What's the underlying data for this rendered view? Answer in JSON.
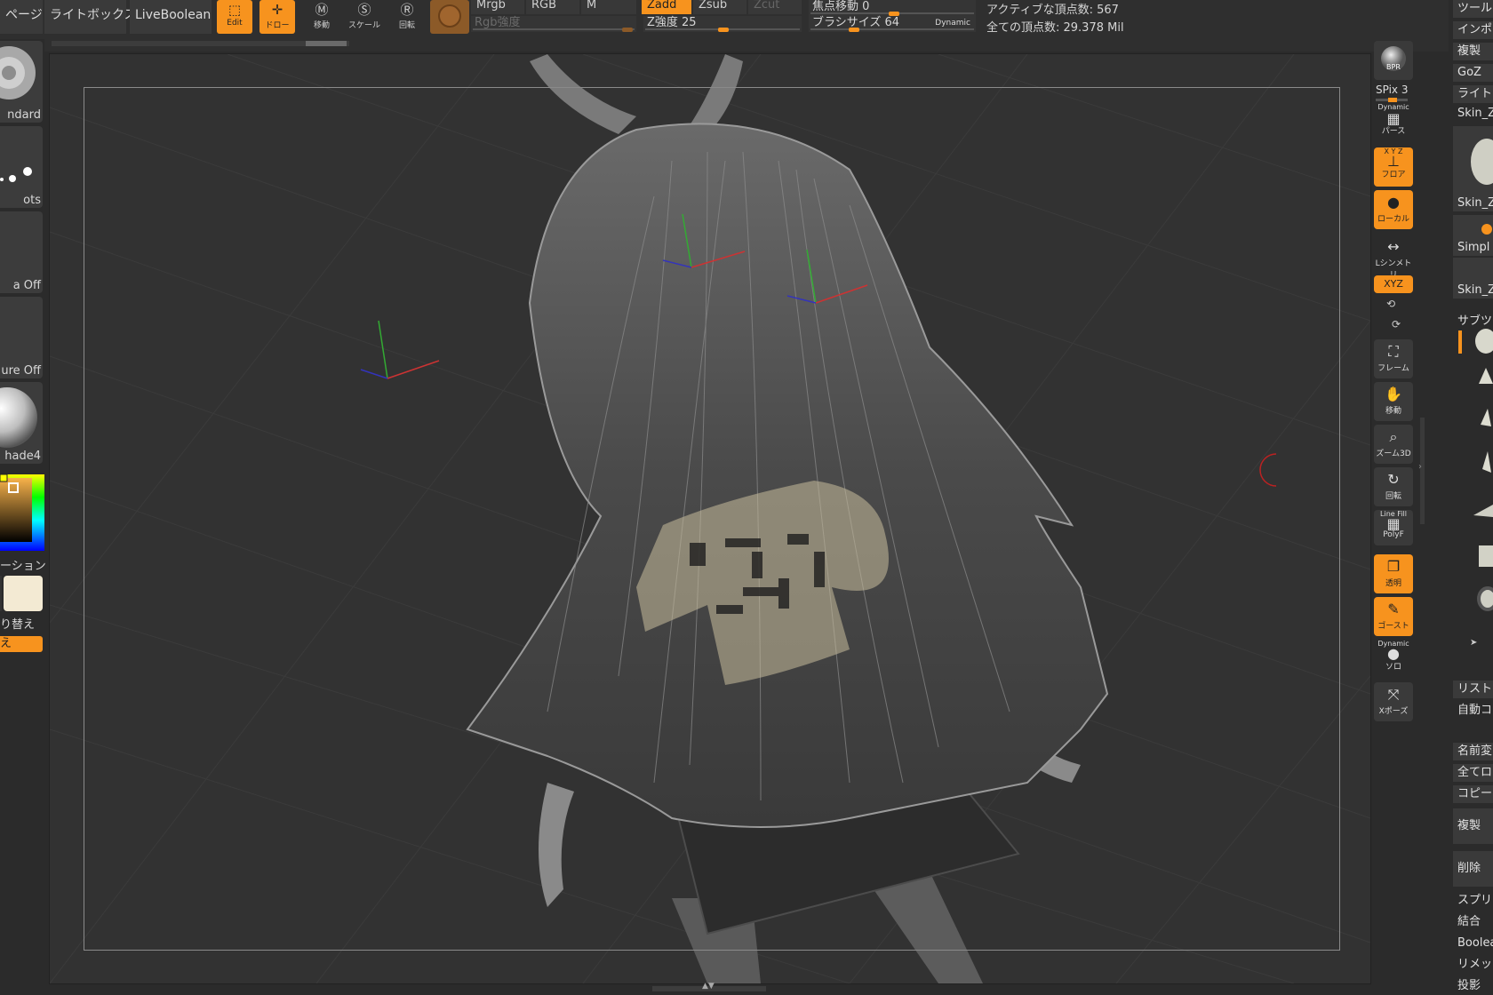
{
  "topbar": {
    "page_partial": "ページ",
    "lightbox": "ライトボックス",
    "liveboolean": "LiveBoolean",
    "edit": "Edit",
    "draw": "ドロー",
    "move": "移動",
    "scale": "スケール",
    "rotate": "回転",
    "mrgb": "Mrgb",
    "rgb": "RGB",
    "m": "M",
    "zadd": "Zadd",
    "zsub": "Zsub",
    "zcut": "Zcut",
    "rgb_intensity": "Rgb強度",
    "z_intensity": "Z強度 25",
    "focal_shift": "焦点移動 0",
    "brush_size": "ブラシサイズ 64",
    "dynamic": "Dynamic",
    "active_points": "アクティブな頂点数: 567",
    "total_points": "全ての頂点数: 29.378 Mil"
  },
  "left": {
    "brush": "ndard",
    "stroke": "ots",
    "alpha": "a Off",
    "texture": "ure Off",
    "material": "hade4",
    "gradient": "ーション",
    "switch": "り替え",
    "orange_btn": "え"
  },
  "shelf": {
    "bpr": "BPR",
    "spix": "SPix 3",
    "dynamic1": "Dynamic",
    "persp": "パース",
    "floor": "フロア",
    "floor_xyz": "X Y Z",
    "local": "ローカル",
    "symmetry": "Lシンメトリ",
    "xyz": "XYZ",
    "frame": "フレーム",
    "move": "移動",
    "zoom3d": "ズーム3D",
    "rotate": "回転",
    "linefill": "Line Fill",
    "polyf": "PolyF",
    "transp": "透明",
    "ghost": "ゴースト",
    "dynamic2": "Dynamic",
    "solo": "ソロ",
    "xpose": "Xポーズ"
  },
  "tool": {
    "tool_partial": "ツール",
    "import": "インポー",
    "clone": "複製",
    "goz": "GoZ",
    "lightbox": "ライト",
    "skin1": "Skin_Z",
    "skin2": "Skin_Z",
    "simple": "Simpl",
    "skin3": "Skin_Z",
    "subtool": "サブツ",
    "list_all": "リスト",
    "auto_collapse": "自動コ",
    "rename": "名前変",
    "all_low": "全てロ",
    "copy": "コピー",
    "duplicate": "複製",
    "delete": "削除",
    "split": "スプリ",
    "merge": "結合",
    "boolean": "Boolea",
    "remesh": "リメッ",
    "project": "投影"
  }
}
